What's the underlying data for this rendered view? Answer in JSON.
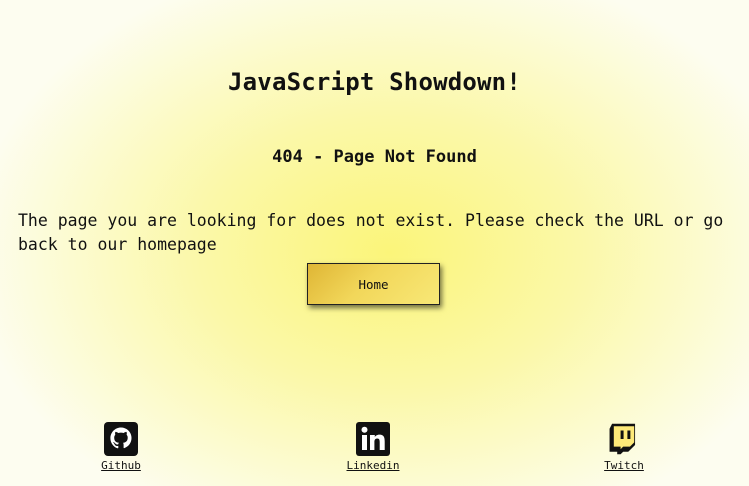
{
  "header": {
    "title": "JavaScript Showdown!"
  },
  "error": {
    "heading": "404 - Page Not Found",
    "message": "The page you are looking for does not exist. Please check the URL or go back to our homepage"
  },
  "actions": {
    "home_label": "Home"
  },
  "footer": {
    "links": [
      {
        "label": "Github",
        "icon": "github-icon"
      },
      {
        "label": "Linkedin",
        "icon": "linkedin-icon"
      },
      {
        "label": "Twitch",
        "icon": "twitch-icon"
      }
    ]
  },
  "colors": {
    "background_center": "#fbf57a",
    "background_edge": "#fdfdf0",
    "button_gold": "#e8c548",
    "text": "#111111"
  }
}
